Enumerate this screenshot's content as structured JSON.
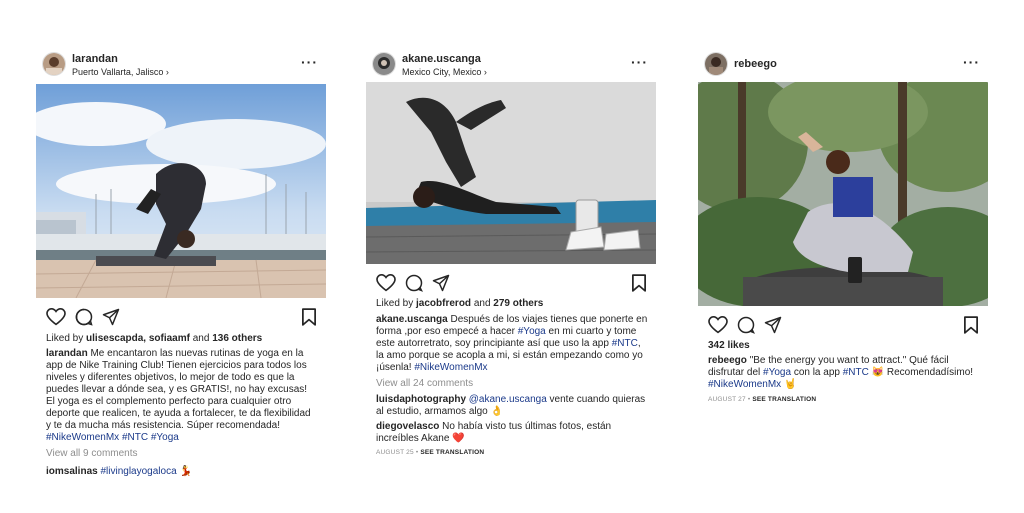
{
  "posts": [
    {
      "username": "larandan",
      "location": "Puerto Vallarta, Jalisco",
      "liked_by_prefix": "Liked by ",
      "liked_by_users": "ulisescapda, sofiaamf",
      "liked_by_and": " and ",
      "liked_by_others": "136 others",
      "caption_text": "Me encantaron las nuevas rutinas de yoga en la app de Nike Training Club! Tienen ejercicios para todos los niveles y diferentes objetivos, lo mejor de todo es que la puedes llevar a dónde sea, y es GRATIS!, no hay excusas! El yoga es el complemento perfecto para cualquier otro deporte que realicen, te ayuda a fortalecer, te da flexibilidad y te da mucha más resistencia. Súper recomendada!",
      "caption_tags": "#NikeWomenMx #NTC #Yoga",
      "view_comments": "View all 9 comments",
      "comment_user": "iomsalinas",
      "comment_tag": "#livinglayogaloca",
      "comment_emoji": "💃"
    },
    {
      "username": "akane.uscanga",
      "location": "Mexico City, Mexico",
      "liked_by_prefix": "Liked by ",
      "liked_by_users": "jacobfrerod",
      "liked_by_and": " and ",
      "liked_by_others": "279 others",
      "caption_part1": "Después de los viajes tienes que ponerte en forma ,por eso empecé a hacer",
      "caption_tag1": "#Yoga",
      "caption_part2": "en mi cuarto y tome este autorretrato, soy principiante así que uso la app",
      "caption_tag2": "#NTC",
      "caption_part3": ", la amo porque se acopla a mi, si están empezando como yo ¡úsenla!",
      "caption_tag3": "#NikeWomenMx",
      "view_comments": "View all 24 comments",
      "comment1_user": "luisdaphotography",
      "comment1_tag": "@akane.uscanga",
      "comment1_text": "vente cuando quieras al estudio, armamos algo 👌",
      "comment2_user": "diegovelasco",
      "comment2_text": "No había visto tus últimas fotos, están increíbles Akane ❤️",
      "date": "AUGUST 25",
      "sep": " • ",
      "see_translation": "SEE TRANSLATION"
    },
    {
      "username": "rebeego",
      "likes": "342 likes",
      "caption_text1": "\"Be the energy you want to attract.\" Qué fácil disfrutar del",
      "caption_tag1": "#Yoga",
      "caption_text2": "con la app",
      "caption_tag2": "#NTC",
      "caption_text3": "😻 Recomendadísimo!",
      "caption_tag3": "#NikeWomenMx",
      "caption_emoji": "🤘",
      "date": "AUGUST 27",
      "sep": " • ",
      "see_translation": "SEE TRANSLATION"
    }
  ],
  "icons": {
    "like": "heart-icon",
    "comment": "comment-icon",
    "share": "share-icon",
    "save": "bookmark-icon",
    "more": "more-icon",
    "chevron": "chevron-right-icon"
  },
  "more_glyph": "···",
  "chevron_glyph": "›"
}
